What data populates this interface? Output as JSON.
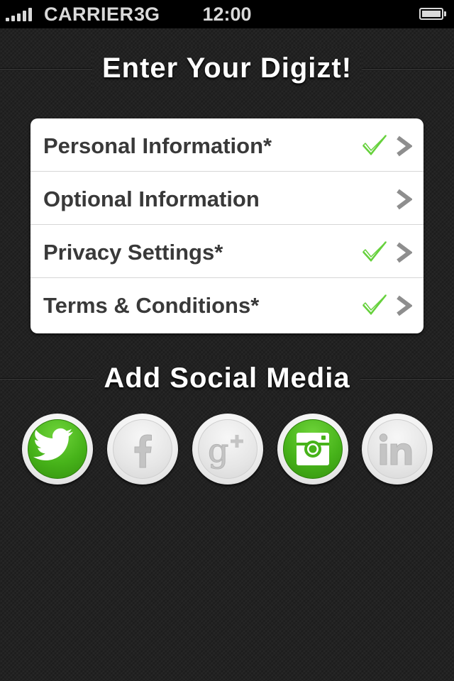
{
  "status_bar": {
    "carrier": "CARRIER",
    "network": "3G",
    "time": "12:00",
    "signal_icon": "signal-bars-icon",
    "battery_icon": "battery-icon"
  },
  "header": {
    "title": "Enter Your Digizt!"
  },
  "info_list": {
    "items": [
      {
        "label": "Personal Information*",
        "completed": true
      },
      {
        "label": "Optional Information",
        "completed": false
      },
      {
        "label": "Privacy Settings*",
        "completed": true
      },
      {
        "label": "Terms & Conditions*",
        "completed": true
      }
    ],
    "check_color": "#66d13c",
    "chevron_color": "#8e8e8e"
  },
  "social": {
    "title": "Add Social Media",
    "services": [
      {
        "name": "twitter",
        "icon": "twitter-bird-icon",
        "connected": true
      },
      {
        "name": "facebook",
        "icon": "facebook-f-icon",
        "connected": false
      },
      {
        "name": "google-plus",
        "icon": "google-plus-icon",
        "connected": false
      },
      {
        "name": "instagram",
        "icon": "instagram-camera-icon",
        "connected": true
      },
      {
        "name": "linkedin",
        "icon": "linkedin-in-icon",
        "connected": false
      }
    ],
    "active_color": "#47b31a",
    "inactive_color": "#e6e6e6"
  }
}
